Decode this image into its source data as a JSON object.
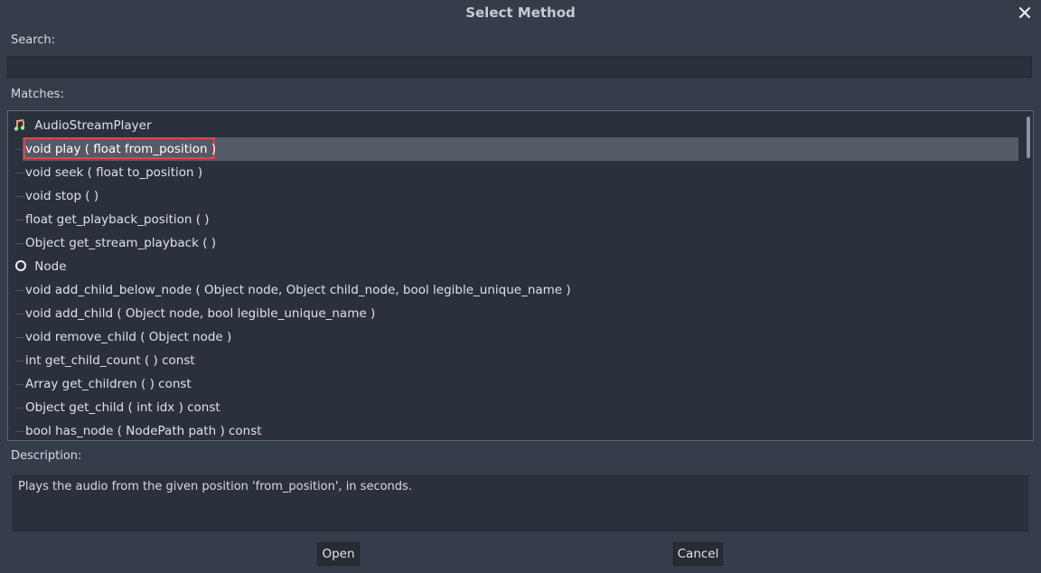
{
  "dialog": {
    "title": "Select Method",
    "close_icon": "close-icon"
  },
  "search": {
    "label": "Search:",
    "value": ""
  },
  "matches": {
    "label": "Matches:",
    "groups": [
      {
        "name": "AudioStreamPlayer",
        "icon": "audio-stream-player-icon",
        "methods": [
          "void  play ( float from_position )",
          "void  seek ( float to_position )",
          "void  stop (  )",
          "float get_playback_position (  )",
          "Object get_stream_playback (  )"
        ]
      },
      {
        "name": "Node",
        "icon": "node-circle-icon",
        "methods": [
          "void  add_child_below_node ( Object node, Object child_node, bool legible_unique_name )",
          "void  add_child ( Object node, bool legible_unique_name )",
          "void  remove_child ( Object node )",
          "int get_child_count (  ) const",
          "Array get_children (  ) const",
          "Object get_child ( int idx ) const",
          "bool has_node ( NodePath path ) const"
        ]
      }
    ],
    "selected_method": "void  play ( float from_position )"
  },
  "description": {
    "label": "Description:",
    "text": "Plays the audio from the given position 'from_position', in seconds."
  },
  "buttons": {
    "open": "Open",
    "cancel": "Cancel"
  },
  "colors": {
    "background": "#363d4a",
    "panel": "#2b313c",
    "selection": "#545a66",
    "highlight_border": "#e5434a"
  }
}
